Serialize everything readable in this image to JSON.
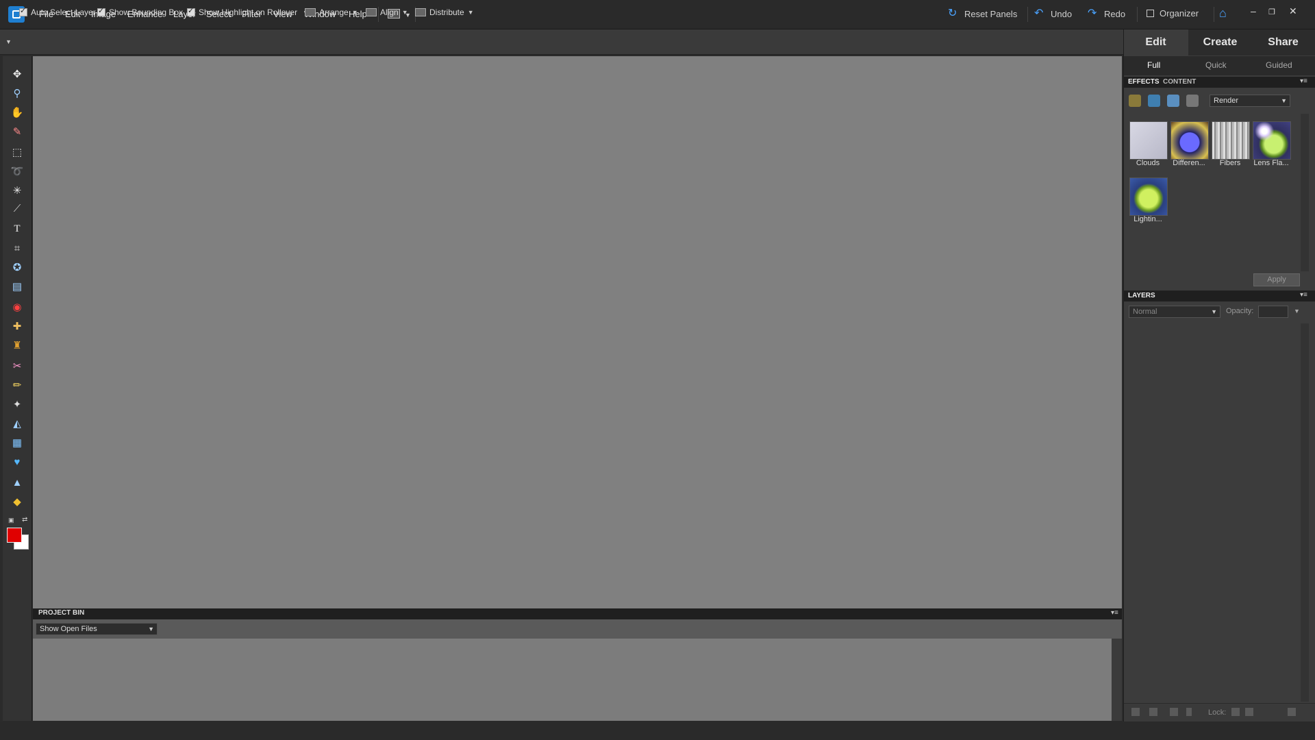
{
  "menubar": {
    "items": [
      "File",
      "Edit",
      "Image",
      "Enhance",
      "Layer",
      "Select",
      "Filter",
      "View",
      "Window",
      "Help"
    ],
    "reset_panels": "Reset Panels",
    "undo": "Undo",
    "redo": "Redo",
    "organizer": "Organizer"
  },
  "options_bar": {
    "auto_select_layer": "Auto Select Layer",
    "show_bounding_box": "Show Bounding Box",
    "show_highlight": "Show Highlight on Rollover",
    "arrange": "Arrange",
    "align": "Align",
    "distribute": "Distribute"
  },
  "colors": {
    "foreground": "#e00000",
    "background": "#ffffff"
  },
  "mode_tabs": [
    "Edit",
    "Create",
    "Share"
  ],
  "sub_tabs": [
    "Full",
    "Quick",
    "Guided"
  ],
  "effects_panel": {
    "tabs": [
      "EFFECTS",
      "CONTENT"
    ],
    "filter_category": "Render",
    "thumbnails": [
      "Clouds",
      "Differen...",
      "Fibers",
      "Lens Fla...",
      "Lightin..."
    ],
    "apply": "Apply"
  },
  "layers_panel": {
    "title": "LAYERS",
    "blend_mode": "Normal",
    "opacity_label": "Opacity:",
    "lock_label": "Lock:"
  },
  "project_bin": {
    "title": "PROJECT BIN",
    "show": "Show Open Files"
  }
}
